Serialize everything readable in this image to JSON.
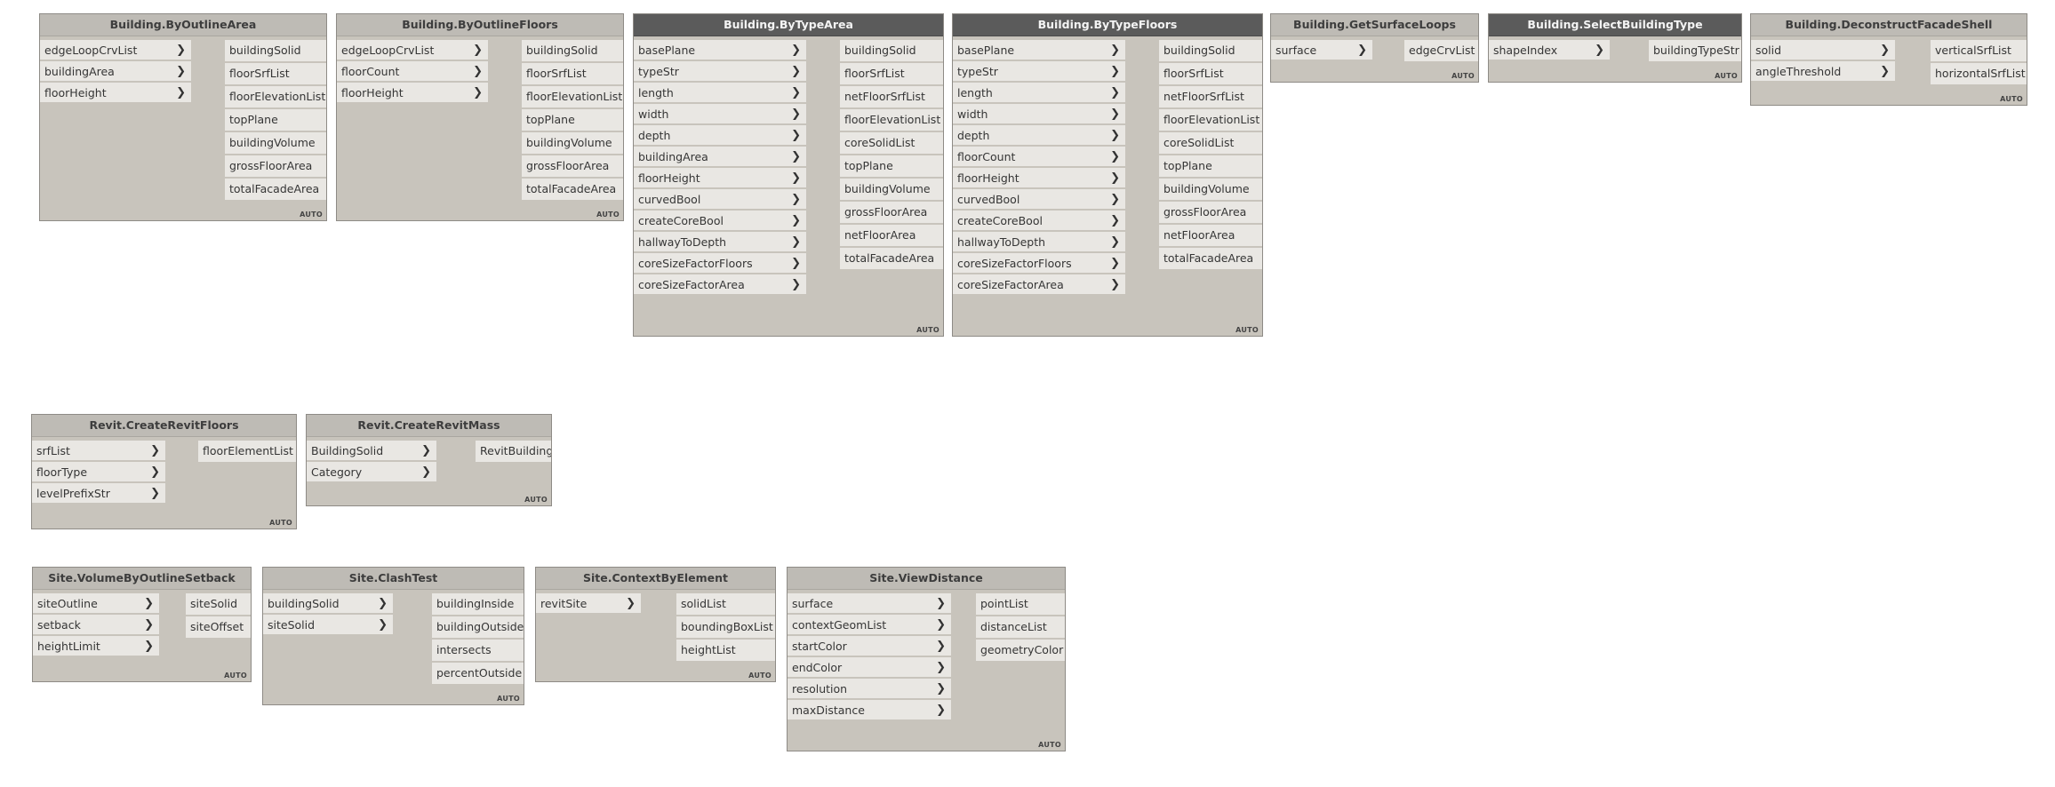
{
  "auto_label": "AUTO",
  "nodes": [
    {
      "title": "Building.ByOutlineArea",
      "selected": false,
      "inputs": [
        "edgeLoopCrvList",
        "buildingArea",
        "floorHeight"
      ],
      "outputs": [
        "buildingSolid",
        "floorSrfList",
        "floorElevationList",
        "topPlane",
        "buildingVolume",
        "grossFloorArea",
        "totalFacadeArea"
      ]
    },
    {
      "title": "Building.ByOutlineFloors",
      "selected": false,
      "inputs": [
        "edgeLoopCrvList",
        "floorCount",
        "floorHeight"
      ],
      "outputs": [
        "buildingSolid",
        "floorSrfList",
        "floorElevationList",
        "topPlane",
        "buildingVolume",
        "grossFloorArea",
        "totalFacadeArea"
      ]
    },
    {
      "title": "Building.ByTypeArea",
      "selected": true,
      "inputs": [
        "basePlane",
        "typeStr",
        "length",
        "width",
        "depth",
        "buildingArea",
        "floorHeight",
        "curvedBool",
        "createCoreBool",
        "hallwayToDepth",
        "coreSizeFactorFloors",
        "coreSizeFactorArea"
      ],
      "outputs": [
        "buildingSolid",
        "floorSrfList",
        "netFloorSrfList",
        "floorElevationList",
        "coreSolidList",
        "topPlane",
        "buildingVolume",
        "grossFloorArea",
        "netFloorArea",
        "totalFacadeArea"
      ]
    },
    {
      "title": "Building.ByTypeFloors",
      "selected": true,
      "inputs": [
        "basePlane",
        "typeStr",
        "length",
        "width",
        "depth",
        "floorCount",
        "floorHeight",
        "curvedBool",
        "createCoreBool",
        "hallwayToDepth",
        "coreSizeFactorFloors",
        "coreSizeFactorArea"
      ],
      "outputs": [
        "buildingSolid",
        "floorSrfList",
        "netFloorSrfList",
        "floorElevationList",
        "coreSolidList",
        "topPlane",
        "buildingVolume",
        "grossFloorArea",
        "netFloorArea",
        "totalFacadeArea"
      ]
    },
    {
      "title": "Building.GetSurfaceLoops",
      "selected": false,
      "inputs": [
        "surface"
      ],
      "outputs": [
        "edgeCrvList"
      ]
    },
    {
      "title": "Building.SelectBuildingType",
      "selected": true,
      "inputs": [
        "shapeIndex"
      ],
      "outputs": [
        "buildingTypeStr"
      ]
    },
    {
      "title": "Building.DeconstructFacadeShell",
      "selected": false,
      "inputs": [
        "solid",
        "angleThreshold"
      ],
      "outputs": [
        "verticalSrfList",
        "horizontalSrfList"
      ]
    },
    {
      "title": "Revit.CreateRevitFloors",
      "selected": false,
      "inputs": [
        "srfList",
        "floorType",
        "levelPrefixStr"
      ],
      "outputs": [
        "floorElementList"
      ]
    },
    {
      "title": "Revit.CreateRevitMass",
      "selected": false,
      "inputs": [
        "BuildingSolid",
        "Category"
      ],
      "outputs": [
        "RevitBuilding"
      ]
    },
    {
      "title": "Site.VolumeByOutlineSetback",
      "selected": false,
      "inputs": [
        "siteOutline",
        "setback",
        "heightLimit"
      ],
      "outputs": [
        "siteSolid",
        "siteOffset"
      ]
    },
    {
      "title": "Site.ClashTest",
      "selected": false,
      "inputs": [
        "buildingSolid",
        "siteSolid"
      ],
      "outputs": [
        "buildingInside",
        "buildingOutside",
        "intersects",
        "percentOutside"
      ]
    },
    {
      "title": "Site.ContextByElement",
      "selected": false,
      "inputs": [
        "revitSite"
      ],
      "outputs": [
        "solidList",
        "boundingBoxList",
        "heightList"
      ]
    },
    {
      "title": "Site.ViewDistance",
      "selected": false,
      "inputs": [
        "surface",
        "contextGeomList",
        "startColor",
        "endColor",
        "resolution",
        "maxDistance"
      ],
      "outputs": [
        "pointList",
        "distanceList",
        "geometryColor"
      ]
    }
  ]
}
